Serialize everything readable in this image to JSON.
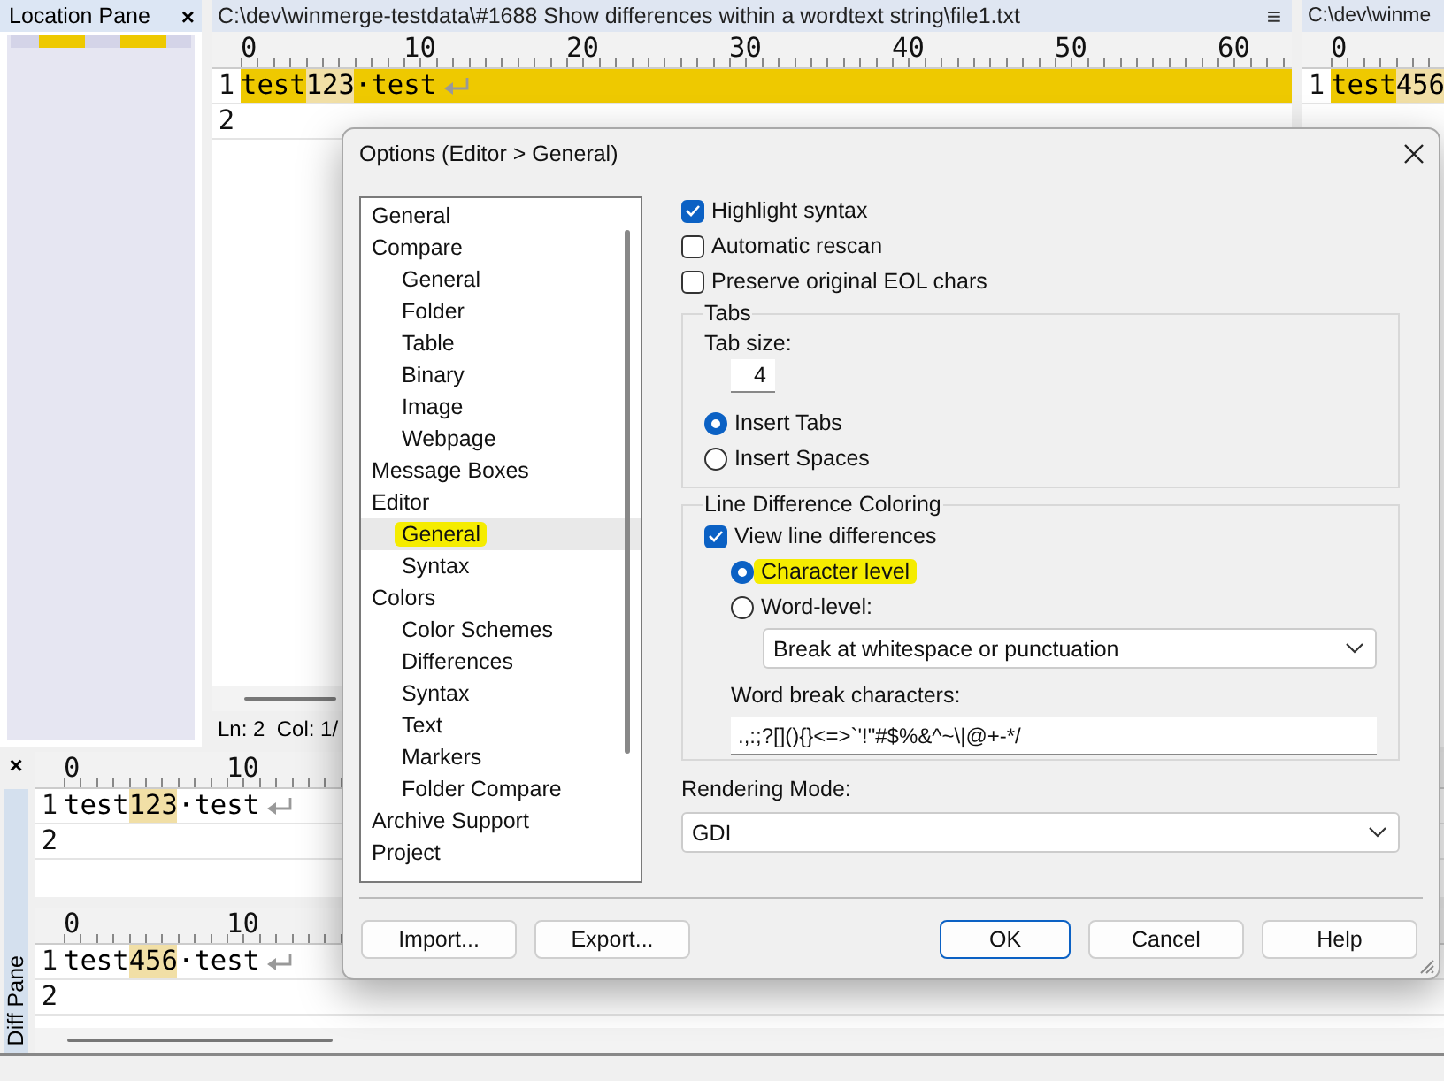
{
  "location_pane": {
    "title": "Location Pane",
    "close": "×"
  },
  "editors": [
    {
      "path": "C:\\dev\\winmerge-testdata\\#1688 Show differences within a wordtext string\\file1.txt",
      "menu": "≡",
      "ruler": [
        "0",
        "10",
        "20",
        "30",
        "40",
        "50",
        "60"
      ],
      "lines": [
        {
          "number": "1",
          "diff": true,
          "eol": true,
          "segments": [
            {
              "text": "test",
              "changed": false
            },
            {
              "text": "123",
              "changed": true
            },
            {
              "text": "·test",
              "changed": false
            }
          ]
        },
        {
          "number": "2",
          "diff": false
        }
      ]
    },
    {
      "path": "C:\\dev\\winme",
      "ruler": [
        "0"
      ],
      "lines": [
        {
          "number": "1",
          "diff": true,
          "segments": [
            {
              "text": "test",
              "changed": false
            },
            {
              "text": "456",
              "changed": true
            }
          ]
        }
      ]
    }
  ],
  "status_bar": {
    "position": "Ln: 2  Col: 1/"
  },
  "diff_pane": {
    "title": "Diff Pane",
    "close": "×",
    "views": [
      {
        "ruler": [
          "0",
          "10"
        ],
        "lines": [
          {
            "number": "1",
            "diff": false,
            "eol": true,
            "segments": [
              {
                "text": "test",
                "changed": false
              },
              {
                "text": "123",
                "changed": true
              },
              {
                "text": "·test",
                "changed": false
              }
            ]
          },
          {
            "number": "2",
            "diff": false
          }
        ]
      },
      {
        "ruler": [
          "0",
          "10"
        ],
        "lines": [
          {
            "number": "1",
            "diff": false,
            "eol": true,
            "segments": [
              {
                "text": "test",
                "changed": false
              },
              {
                "text": "456",
                "changed": true
              },
              {
                "text": "·test",
                "changed": false
              }
            ]
          },
          {
            "number": "2",
            "diff": false
          }
        ]
      }
    ]
  },
  "dialog": {
    "title": "Options (Editor > General)",
    "tree": [
      {
        "label": "General",
        "selected": false,
        "highlighted": false
      },
      {
        "label": "Compare",
        "selected": false,
        "highlighted": false,
        "children": [
          {
            "label": "General",
            "selected": false,
            "highlighted": false
          },
          {
            "label": "Folder",
            "selected": false,
            "highlighted": false
          },
          {
            "label": "Table",
            "selected": false,
            "highlighted": false
          },
          {
            "label": "Binary",
            "selected": false,
            "highlighted": false
          },
          {
            "label": "Image",
            "selected": false,
            "highlighted": false
          },
          {
            "label": "Webpage",
            "selected": false,
            "highlighted": false
          }
        ]
      },
      {
        "label": "Message Boxes",
        "selected": false,
        "highlighted": false
      },
      {
        "label": "Editor",
        "selected": false,
        "highlighted": false,
        "children": [
          {
            "label": "General",
            "selected": true,
            "highlighted": true
          },
          {
            "label": "Syntax",
            "selected": false,
            "highlighted": false
          }
        ]
      },
      {
        "label": "Colors",
        "selected": false,
        "highlighted": false,
        "children": [
          {
            "label": "Color Schemes",
            "selected": false,
            "highlighted": false
          },
          {
            "label": "Differences",
            "selected": false,
            "highlighted": false
          },
          {
            "label": "Syntax",
            "selected": false,
            "highlighted": false
          },
          {
            "label": "Text",
            "selected": false,
            "highlighted": false
          },
          {
            "label": "Markers",
            "selected": false,
            "highlighted": false
          },
          {
            "label": "Folder Compare",
            "selected": false,
            "highlighted": false
          }
        ]
      },
      {
        "label": "Archive Support",
        "selected": false,
        "highlighted": false
      },
      {
        "label": "Project",
        "selected": false,
        "highlighted": false
      }
    ],
    "options": [
      {
        "label": "Highlight syntax",
        "checked": true
      },
      {
        "label": "Automatic rescan",
        "checked": false
      },
      {
        "label": "Preserve original EOL chars",
        "checked": false
      }
    ],
    "tabs_group": {
      "title": "Tabs",
      "tab_size_label": "Tab size:",
      "tab_size": "4",
      "radios": [
        {
          "label": "Insert Tabs",
          "selected": true
        },
        {
          "label": "Insert Spaces",
          "selected": false
        }
      ]
    },
    "line_diff_group": {
      "title": "Line Difference Coloring",
      "view_line_differences": {
        "label": "View line differences",
        "checked": true
      },
      "radios": [
        {
          "label": "Character level",
          "selected": true,
          "highlighted": true
        },
        {
          "label": "Word-level:",
          "selected": false,
          "highlighted": false
        }
      ],
      "word_level_mode": "Break at whitespace or punctuation",
      "word_break_label": "Word break characters:",
      "word_break_chars": ".,:;?[](){}<=>`'!\"#$%&^~\\|@+-*/"
    },
    "rendering_mode": {
      "label": "Rendering Mode:",
      "value": "GDI"
    },
    "buttons": [
      {
        "label": "Import...",
        "default": false
      },
      {
        "label": "Export...",
        "default": false
      },
      {
        "label": "OK",
        "default": true
      },
      {
        "label": "Cancel",
        "default": false
      },
      {
        "label": "Help",
        "default": false
      }
    ]
  }
}
